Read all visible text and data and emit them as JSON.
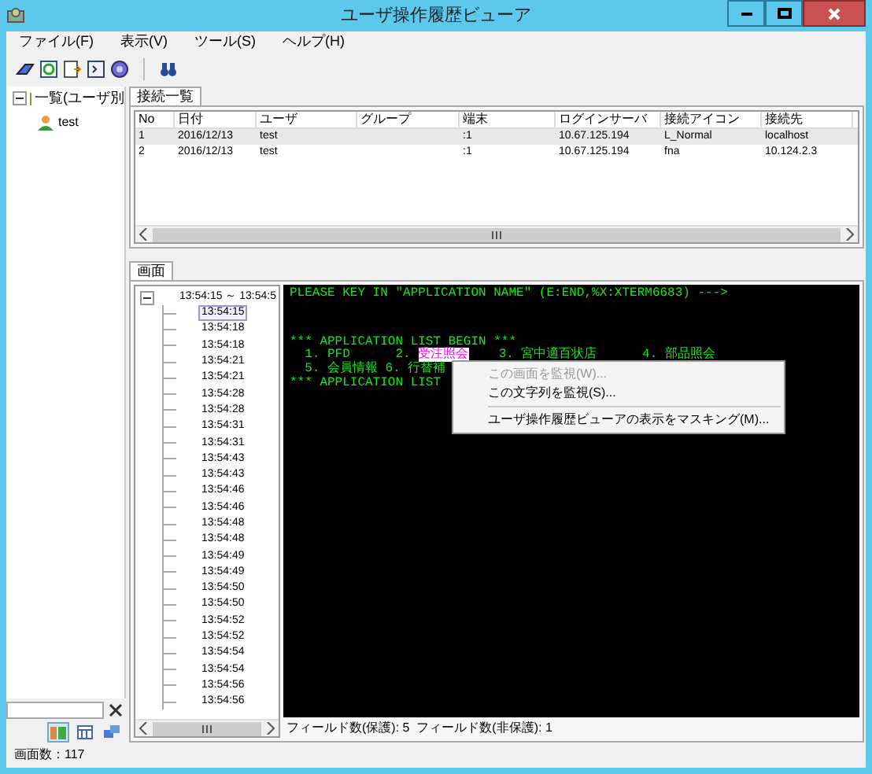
{
  "window": {
    "title": "ユーザ操作履歴ビューア"
  },
  "menu": [
    "ファイル(F)",
    "表示(V)",
    "ツール(S)",
    "ヘルプ(H)"
  ],
  "sidebar": {
    "tree": [
      {
        "label": "一覧(ユーザ別",
        "expanded": true,
        "children": [
          {
            "label": "test"
          }
        ]
      }
    ],
    "view_buttons": [
      {
        "selected": true
      },
      {
        "selected": false
      },
      {
        "selected": false
      }
    ]
  },
  "connections": {
    "tab": "接続一覧",
    "columns": [
      "No",
      "日付",
      "ユーザ",
      "グループ",
      "端末",
      "ログインサーバ",
      "接続アイコン",
      "接続先"
    ],
    "rows": [
      {
        "selected": true,
        "cells": [
          "1",
          "2016/12/13",
          "test",
          "",
          ":1",
          "10.67.125.194",
          "L_Normal",
          "localhost"
        ]
      },
      {
        "selected": false,
        "cells": [
          "2",
          "2016/12/13",
          "test",
          "",
          ":1",
          "10.67.125.194",
          "fna",
          "10.124.2.3"
        ]
      }
    ]
  },
  "screens": {
    "tab": "画面",
    "tree": {
      "label": "13:54:15 ～ 13:54:5",
      "expanded": true,
      "children": [
        {
          "label": "13:54:15",
          "selected": true
        },
        {
          "label": "13:54:18",
          "selected": false
        },
        {
          "label": "13:54:18",
          "selected": false
        },
        {
          "label": "13:54:21",
          "selected": false
        },
        {
          "label": "13:54:21",
          "selected": false
        },
        {
          "label": "13:54:28",
          "selected": false
        },
        {
          "label": "13:54:28",
          "selected": false
        },
        {
          "label": "13:54:31",
          "selected": false
        },
        {
          "label": "13:54:31",
          "selected": false
        },
        {
          "label": "13:54:43",
          "selected": false
        },
        {
          "label": "13:54:43",
          "selected": false
        },
        {
          "label": "13:54:46",
          "selected": false
        },
        {
          "label": "13:54:46",
          "selected": false
        },
        {
          "label": "13:54:48",
          "selected": false
        },
        {
          "label": "13:54:48",
          "selected": false
        },
        {
          "label": "13:54:49",
          "selected": false
        },
        {
          "label": "13:54:49",
          "selected": false
        },
        {
          "label": "13:54:50",
          "selected": false
        },
        {
          "label": "13:54:50",
          "selected": false
        },
        {
          "label": "13:54:52",
          "selected": false
        },
        {
          "label": "13:54:52",
          "selected": false
        },
        {
          "label": "13:54:54",
          "selected": false
        },
        {
          "label": "13:54:54",
          "selected": false
        },
        {
          "label": "13:54:56",
          "selected": false
        },
        {
          "label": "13:54:56",
          "selected": false
        }
      ]
    },
    "terminal": {
      "lines": [
        [
          {
            "text": "PLEASE KEY IN \"APPLICATION NAME\" (E:END,%X:XTERM6683) --->",
            "highlighted": false
          }
        ],
        [
          {
            "text": "*** APPLICATION LIST BEGIN ***",
            "highlighted": false
          }
        ],
        [
          {
            "text": "  1. PFD      2. ",
            "highlighted": false
          },
          {
            "text": "受注照会",
            "highlighted": true
          },
          {
            "text": "    3. 宮中適百状店      4. 部品照会",
            "highlighted": false
          }
        ],
        [
          {
            "text": "  5. 会員情報 6. 行替補",
            "highlighted": false
          }
        ],
        [
          {
            "text": "*** APPLICATION LIST",
            "highlighted": false
          }
        ]
      ]
    },
    "context_menu": [
      {
        "kind": "item",
        "label": "この画面を監視(W)...",
        "disabled": true
      },
      {
        "kind": "item",
        "label": "この文字列を監視(S)...",
        "disabled": false
      },
      {
        "kind": "separator"
      },
      {
        "kind": "item",
        "label": "ユーザ操作履歴ビューアの表示をマスキング(M)...",
        "disabled": false
      }
    ],
    "field_info": "フィールド数(保護): 5  フィールド数(非保護): 1"
  },
  "status_bar": "画面数：117"
}
